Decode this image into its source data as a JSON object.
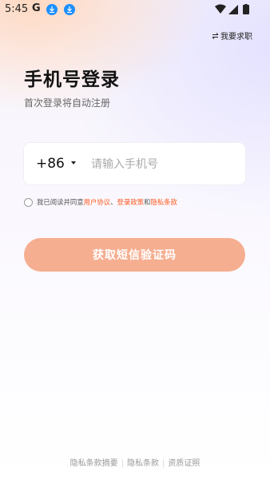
{
  "status_bar": {
    "time": "5:45",
    "g_glyph": "G",
    "icons": [
      "download-icon",
      "download-icon",
      "wifi-icon",
      "signal-icon",
      "battery-icon"
    ]
  },
  "header": {
    "switch_label": "我要求职",
    "switch_icon": "swap-icon"
  },
  "title": "手机号登录",
  "subtitle": "首次登录将自动注册",
  "phone": {
    "country_code": "+86",
    "placeholder": "请输入手机号",
    "value": ""
  },
  "agreement": {
    "prefix": "我已阅读并同意",
    "link1": "用户协议",
    "sep1": "、",
    "link2": "登录政策",
    "sep2": "和",
    "link3": "隐私条款"
  },
  "sms_button": "获取短信验证码",
  "footer": {
    "links": [
      "隐私条款摘要",
      "隐私条款",
      "资质证照"
    ]
  },
  "colors": {
    "accent": "#ff5a1f",
    "button_bg": "#f6ae90",
    "download_badge": "#1e90ff"
  }
}
